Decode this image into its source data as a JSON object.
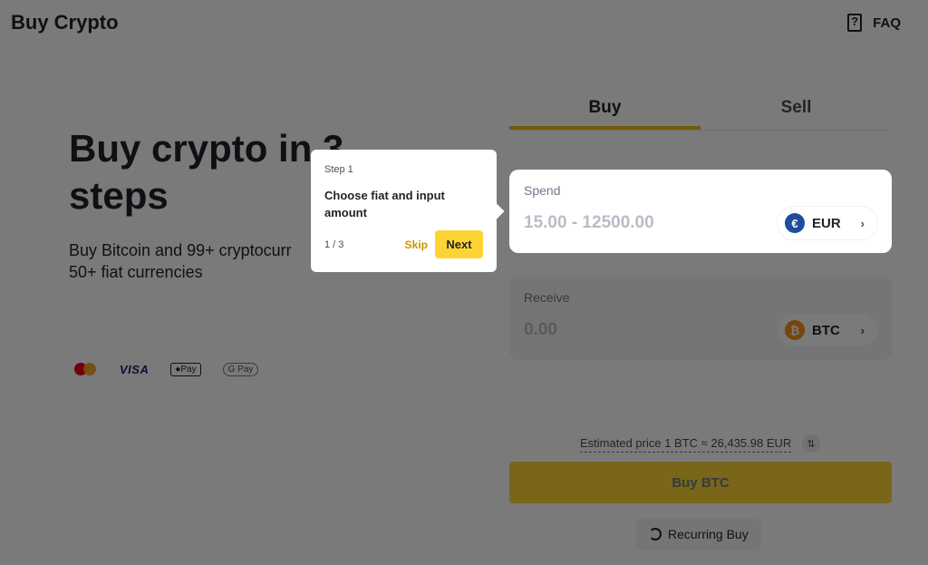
{
  "header": {
    "title": "Buy Crypto",
    "faq_label": "FAQ",
    "faq_icon": "faq-book-icon"
  },
  "hero": {
    "title": "Buy crypto in 3 steps",
    "subtitle_line1": "Buy Bitcoin and 99+ cryptocurr",
    "subtitle_line2": "50+ fiat currencies"
  },
  "payments": {
    "mastercard": "mastercard-icon",
    "visa": "VISA",
    "applepay": "●Pay",
    "gpay": "G Pay"
  },
  "tabs": [
    {
      "label": "Buy",
      "active": true
    },
    {
      "label": "Sell",
      "active": false
    }
  ],
  "spend": {
    "label": "Spend",
    "placeholder": "15.00 - 12500.00",
    "currency": "EUR",
    "coin_symbol": "€"
  },
  "receive": {
    "label": "Receive",
    "value": "0.00",
    "currency": "BTC",
    "coin_symbol": "₿"
  },
  "estimate": {
    "text": "Estimated price 1 BTC ≈ 26,435.98 EUR",
    "swap_icon": "⇅"
  },
  "buy_button": {
    "label": "Buy BTC"
  },
  "recurring": {
    "label": "Recurring Buy"
  },
  "tooltip": {
    "step": "Step 1",
    "text": "Choose fiat and input amount",
    "count": "1 / 3",
    "skip": "Skip",
    "next": "Next"
  },
  "colors": {
    "accent": "#fcd535",
    "accent_dark": "#f0b90b",
    "overlay": "rgba(0,0,0,0.52)"
  }
}
